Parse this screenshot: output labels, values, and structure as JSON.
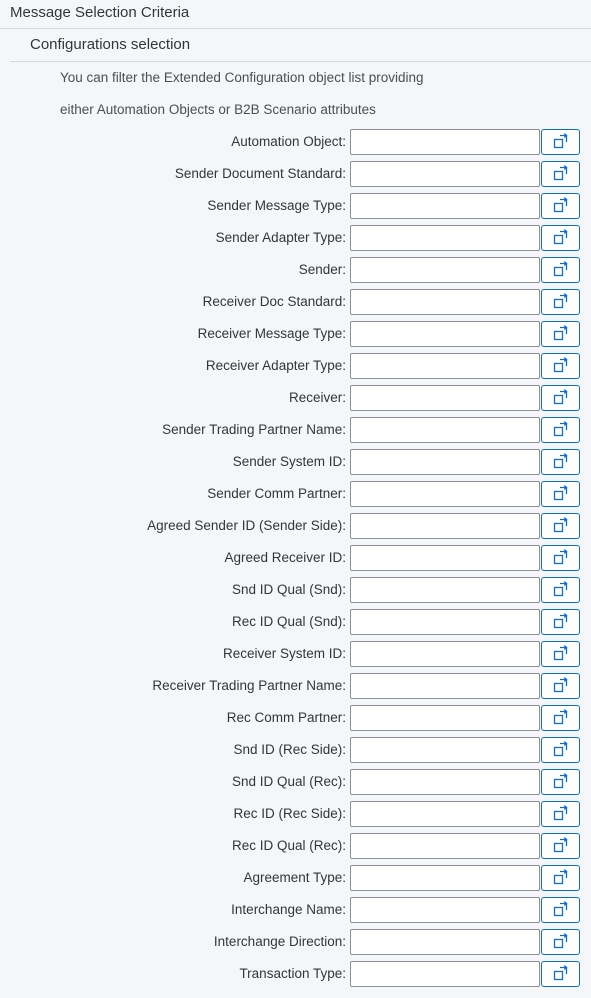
{
  "section": {
    "title": "Message Selection Criteria"
  },
  "group": {
    "title": "Configurations selection",
    "info_line_1": "You can filter the Extended Configuration object list providing",
    "info_line_2": "either Automation Objects or B2B Scenario attributes"
  },
  "fields": [
    {
      "label": "Automation Object:",
      "value": ""
    },
    {
      "label": "Sender Document Standard:",
      "value": ""
    },
    {
      "label": "Sender Message Type:",
      "value": ""
    },
    {
      "label": "Sender Adapter Type:",
      "value": ""
    },
    {
      "label": "Sender:",
      "value": ""
    },
    {
      "label": "Receiver Doc Standard:",
      "value": ""
    },
    {
      "label": "Receiver Message Type:",
      "value": ""
    },
    {
      "label": "Receiver Adapter Type:",
      "value": ""
    },
    {
      "label": "Receiver:",
      "value": ""
    },
    {
      "label": "Sender Trading Partner Name:",
      "value": ""
    },
    {
      "label": "Sender System ID:",
      "value": ""
    },
    {
      "label": "Sender Comm Partner:",
      "value": ""
    },
    {
      "label": "Agreed Sender ID (Sender Side):",
      "value": ""
    },
    {
      "label": "Agreed Receiver ID:",
      "value": ""
    },
    {
      "label": "Snd ID Qual (Snd):",
      "value": ""
    },
    {
      "label": "Rec ID Qual (Snd):",
      "value": ""
    },
    {
      "label": "Receiver System ID:",
      "value": ""
    },
    {
      "label": "Receiver Trading Partner Name:",
      "value": ""
    },
    {
      "label": "Rec Comm Partner:",
      "value": ""
    },
    {
      "label": "Snd ID (Rec Side):",
      "value": ""
    },
    {
      "label": "Snd ID Qual (Rec):",
      "value": ""
    },
    {
      "label": "Rec ID (Rec Side):",
      "value": ""
    },
    {
      "label": "Rec ID Qual (Rec):",
      "value": ""
    },
    {
      "label": "Agreement Type:",
      "value": ""
    },
    {
      "label": "Interchange Name:",
      "value": ""
    },
    {
      "label": "Interchange Direction:",
      "value": ""
    },
    {
      "label": "Transaction Type:",
      "value": ""
    }
  ],
  "value_help_icon": "value-help-icon",
  "colors": {
    "background": "#f5f6f7",
    "accent": "#0a6ed1",
    "field_border": "#89919a",
    "text": "#32363a"
  }
}
